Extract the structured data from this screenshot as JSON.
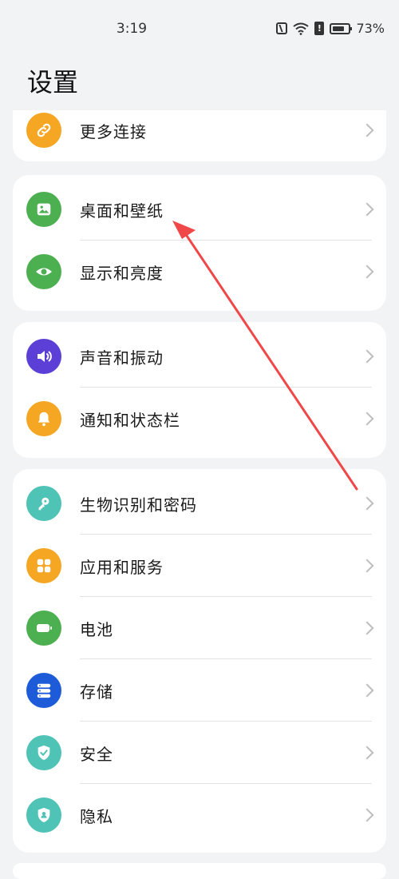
{
  "status_bar": {
    "time": "3:19",
    "battery_percent": "73%",
    "battery_level": 0.73
  },
  "page": {
    "title": "设置"
  },
  "groups": [
    {
      "items": [
        {
          "label": "更多连接",
          "icon": "link-icon",
          "color": "#f5a623"
        }
      ]
    },
    {
      "items": [
        {
          "label": "桌面和壁纸",
          "icon": "image-icon",
          "color": "#4caf50"
        },
        {
          "label": "显示和亮度",
          "icon": "eye-icon",
          "color": "#4caf50"
        }
      ]
    },
    {
      "items": [
        {
          "label": "声音和振动",
          "icon": "speaker-icon",
          "color": "#5b3fd6"
        },
        {
          "label": "通知和状态栏",
          "icon": "bell-icon",
          "color": "#f5a623"
        }
      ]
    },
    {
      "items": [
        {
          "label": "生物识别和密码",
          "icon": "key-icon",
          "color": "#4fc3b5"
        },
        {
          "label": "应用和服务",
          "icon": "apps-grid-icon",
          "color": "#f5a623"
        },
        {
          "label": "电池",
          "icon": "battery-icon",
          "color": "#4caf50"
        },
        {
          "label": "存储",
          "icon": "storage-icon",
          "color": "#1e5bd8"
        },
        {
          "label": "安全",
          "icon": "shield-check-icon",
          "color": "#4fc3b5"
        },
        {
          "label": "隐私",
          "icon": "privacy-shield-icon",
          "color": "#4fc3b5"
        }
      ]
    }
  ],
  "colors": {
    "background": "#f1f3f5",
    "card": "#ffffff",
    "annotation_arrow": "#f04848"
  }
}
